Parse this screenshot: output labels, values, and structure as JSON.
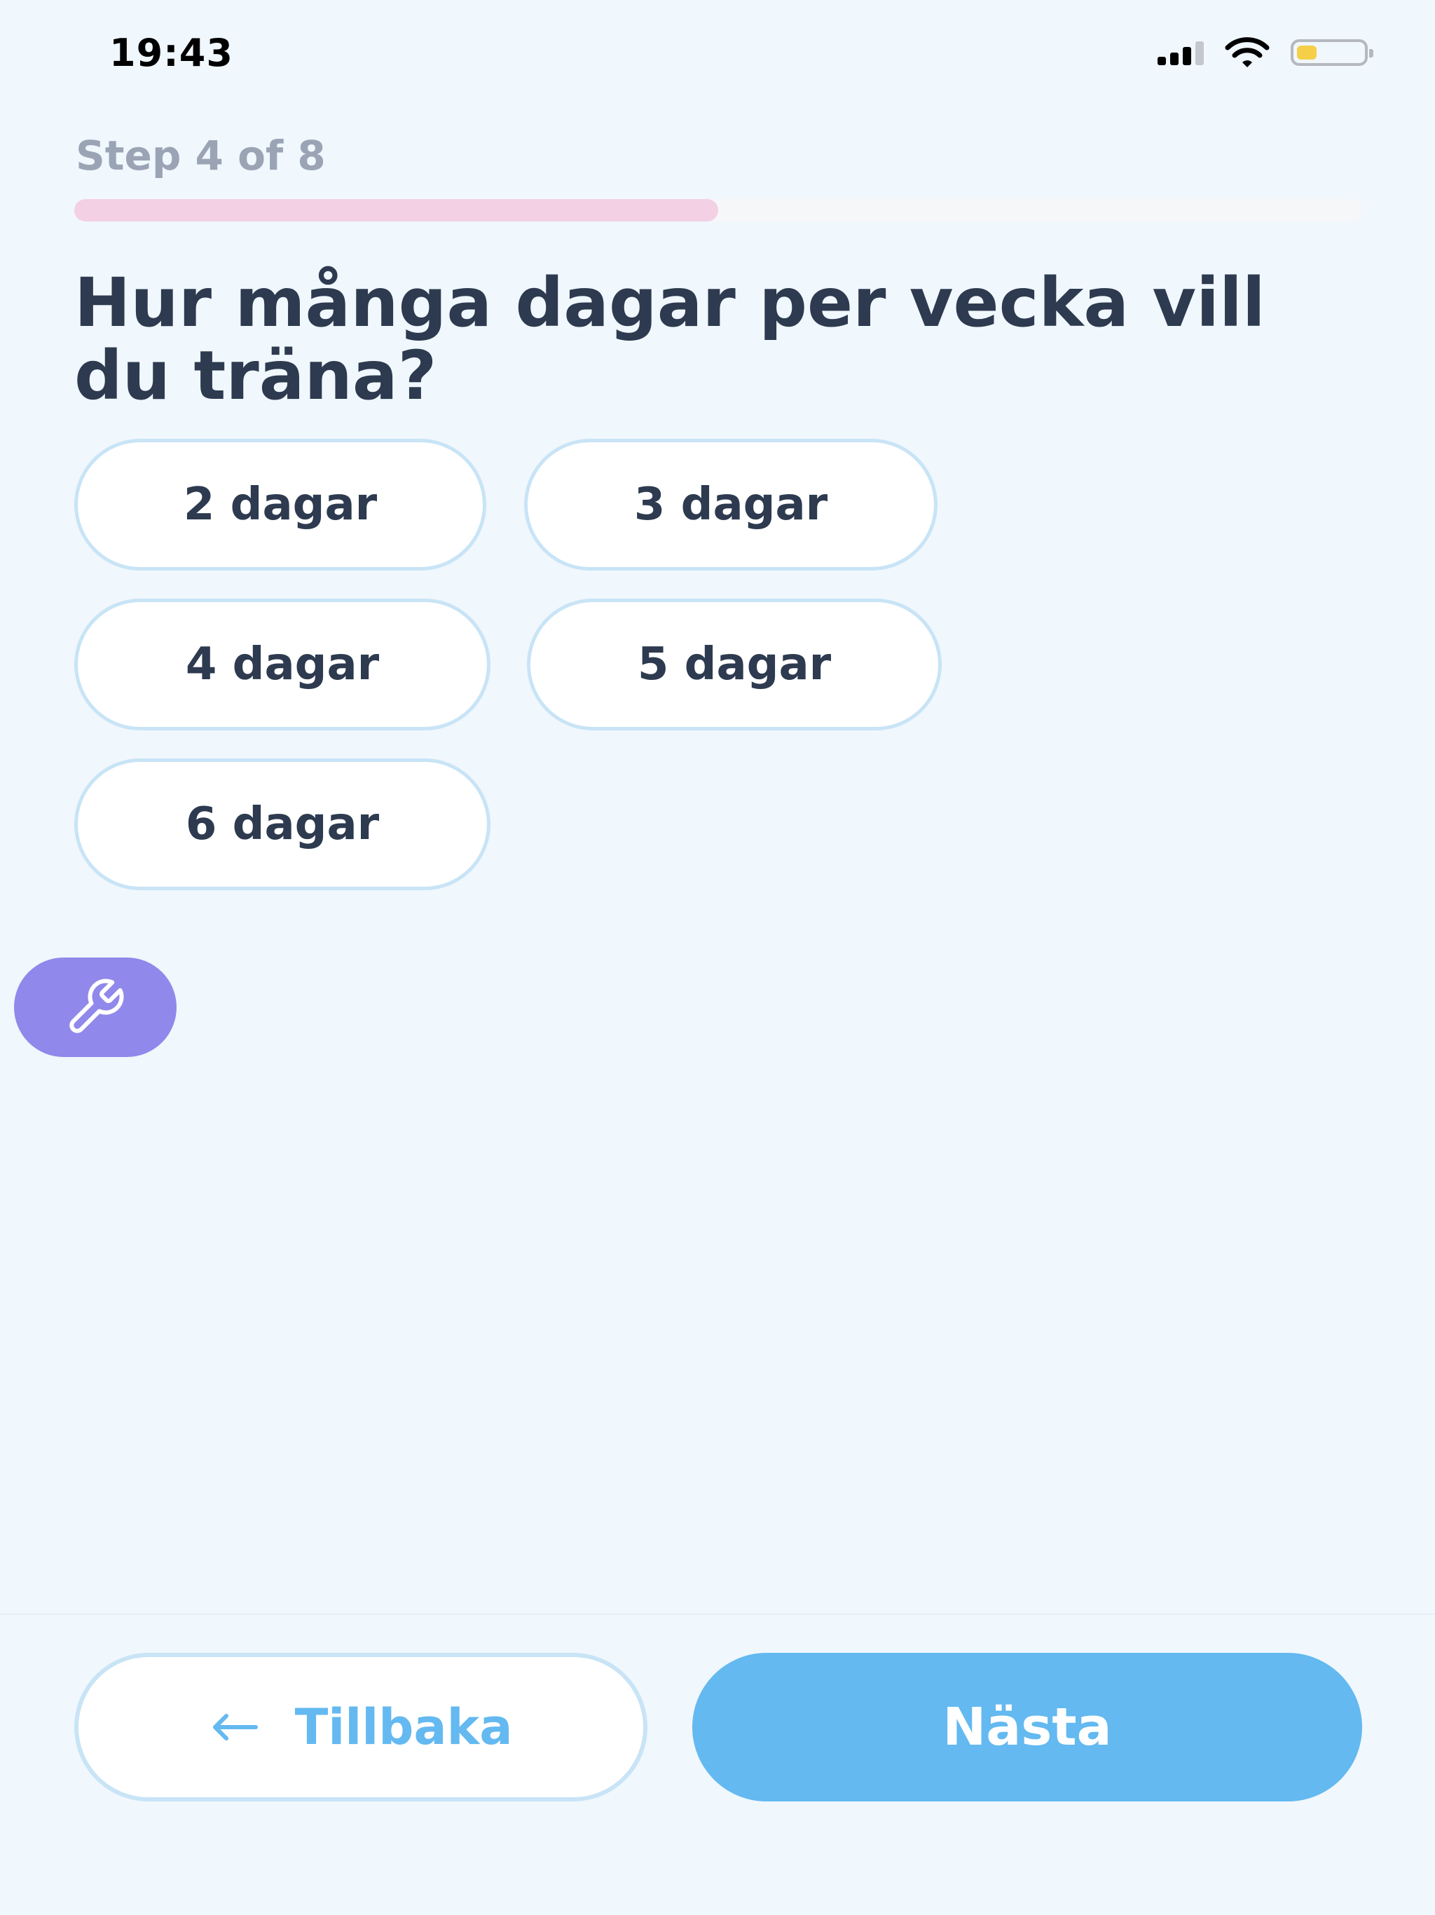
{
  "status_bar": {
    "time": "19:43",
    "signal_icon": "cellular-signal-icon",
    "wifi_icon": "wifi-icon",
    "battery_icon": "battery-icon",
    "battery_level": 0.3,
    "battery_color": "#f5cf47"
  },
  "step": {
    "label": "Step 4 of 8",
    "current": 4,
    "total": 8,
    "progress_fraction": 0.5,
    "progress_color": "#f4d0e4"
  },
  "question": {
    "title": "Hur många dagar per vecka vill du träna?"
  },
  "options": [
    {
      "label": "2 dagar"
    },
    {
      "label": "3 dagar"
    },
    {
      "label": "4 dagar"
    },
    {
      "label": "5 dagar"
    },
    {
      "label": "6 dagar"
    }
  ],
  "tool_button": {
    "icon": "wrench-icon",
    "color": "#9088ea"
  },
  "footer": {
    "back_label": "Tillbaka",
    "back_icon": "arrow-left-icon",
    "next_label": "Nästa",
    "accent_color": "#63b9f0"
  }
}
